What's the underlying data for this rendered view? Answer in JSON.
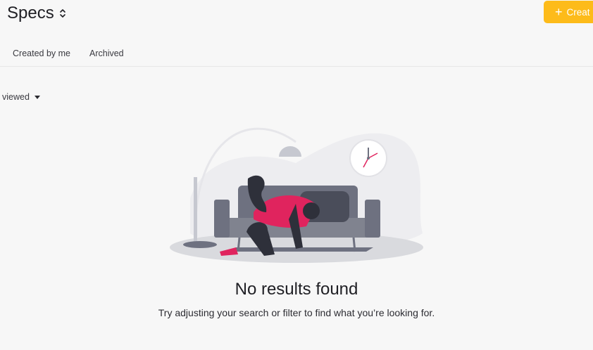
{
  "header": {
    "title": "Specs",
    "title_icon": "sort-arrows-icon",
    "create_button": {
      "label": "Creat",
      "icon": "plus-icon",
      "color": "#fdbb1a"
    }
  },
  "tabs": [
    {
      "label": "Created by me"
    },
    {
      "label": "Archived"
    }
  ],
  "sort": {
    "label": "viewed",
    "icon": "caret-down-icon"
  },
  "empty_state": {
    "illustration": "person-on-couch-illustration",
    "title": "No results found",
    "message": "Try adjusting your search or filter to find what you’re looking for."
  },
  "colors": {
    "accent": "#fdbb1a",
    "background": "#f7f7f7",
    "illustration_pink": "#e0245e",
    "illustration_slate": "#6e7180"
  }
}
